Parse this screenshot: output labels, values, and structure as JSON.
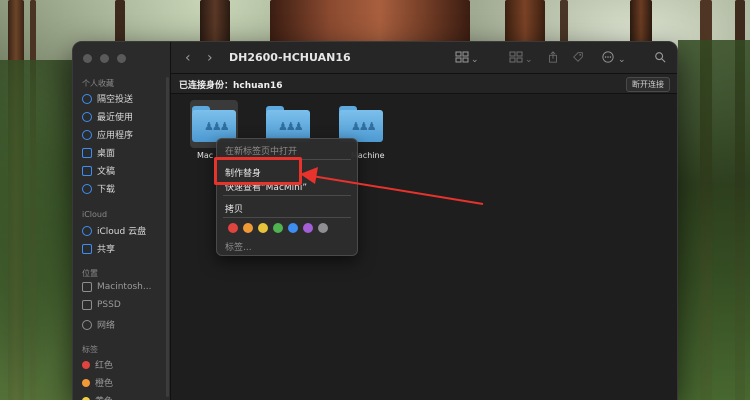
{
  "window": {
    "title": "DH2600-HCHUAN16",
    "connected_label": "已连接身份：hchuan16",
    "disconnect_label": "断开连接"
  },
  "sidebar": {
    "favorites_header": "个人收藏",
    "favorites": [
      {
        "label": "隔空投送",
        "icon": "airdrop-icon"
      },
      {
        "label": "最近使用",
        "icon": "clock-icon"
      },
      {
        "label": "应用程序",
        "icon": "applications-icon"
      },
      {
        "label": "桌面",
        "icon": "desktop-icon"
      },
      {
        "label": "文稿",
        "icon": "document-icon"
      },
      {
        "label": "下载",
        "icon": "download-icon"
      }
    ],
    "icloud_header": "iCloud",
    "icloud": [
      {
        "label": "iCloud 云盘",
        "icon": "cloud-icon"
      },
      {
        "label": "共享",
        "icon": "shared-folder-icon"
      }
    ],
    "locations_header": "位置",
    "locations": [
      {
        "label": "Macintosh...",
        "icon": "disk-icon"
      },
      {
        "label": "PSSD",
        "icon": "disk-icon"
      },
      {
        "label": "网络",
        "icon": "network-icon"
      }
    ],
    "tags_header": "标签",
    "tags": [
      {
        "label": "红色",
        "color": "#e0443e"
      },
      {
        "label": "橙色",
        "color": "#f09a37"
      },
      {
        "label": "黄色",
        "color": "#f5cf3f"
      }
    ]
  },
  "folders": [
    {
      "label": "Mac",
      "selected": true
    },
    {
      "label": "",
      "selected": false
    },
    {
      "label": "Machine",
      "selected": false
    }
  ],
  "context_menu": {
    "items": {
      "open_new_tab": "在新标签页中打开",
      "make_alias": "制作替身",
      "quick_look": "快速查看“MacMini”",
      "copy": "拷贝",
      "tags": "标签..."
    },
    "tag_colors": [
      "#e0443e",
      "#f09a37",
      "#e6c33a",
      "#4fb34f",
      "#3d8ef0",
      "#a45fd6",
      "#8e8e93"
    ]
  },
  "colors": {
    "accent": "#3d8ef0",
    "annotation": "#e8322c"
  }
}
